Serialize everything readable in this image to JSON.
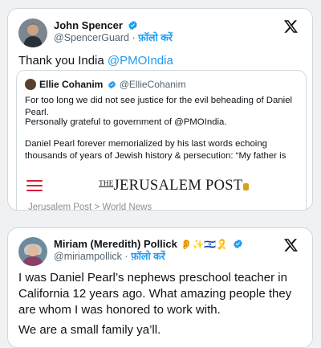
{
  "tweet1": {
    "author": {
      "name": "John Spencer",
      "handle": "@SpencerGuard",
      "separator": "·",
      "follow_label": "फ़ॉलो करें"
    },
    "text_prefix": "Thank you India ",
    "text_mention": "@PMOIndia",
    "quote": {
      "author_name": "Ellie Cohanim",
      "author_handle": "@EllieCohanim",
      "para1": "For too long we did not see justice for the evil beheading of Daniel Pearl.",
      "para2": "Personally grateful to government of @PMOIndia.",
      "para3": "Daniel Pearl forever memorialized by his last words echoing thousands of years of Jewish history & persecution: “My father is Jewish, my mother is",
      "link_card": {
        "logo_prefix": "THE",
        "logo_main": "JERUSALEM POST",
        "breadcrumb": "Jerusalem Post > World News"
      }
    }
  },
  "tweet2": {
    "author": {
      "name": "Miriam (Meredith) Pollick",
      "name_emoji": "👂✨🇮🇱🎗️",
      "handle": "@miriampollick",
      "separator": "·",
      "follow_label": "फ़ॉलो करें"
    },
    "para1": "I was Daniel Pearl’s nephews preschool teacher in California 12 years ago. What amazing people they are whom I was honored to work with.",
    "para2": "We are a small family ya’ll."
  },
  "colors": {
    "accent": "#1d9bf0",
    "verified": "#1d9bf0",
    "muted_text": "#536471",
    "border": "#cfd9de",
    "background": "#f0f1f2",
    "jp_red": "#d61f3a"
  },
  "icons": {
    "platform": "x-logo-icon",
    "verified": "verified-badge-icon",
    "menu": "hamburger-menu-icon"
  }
}
